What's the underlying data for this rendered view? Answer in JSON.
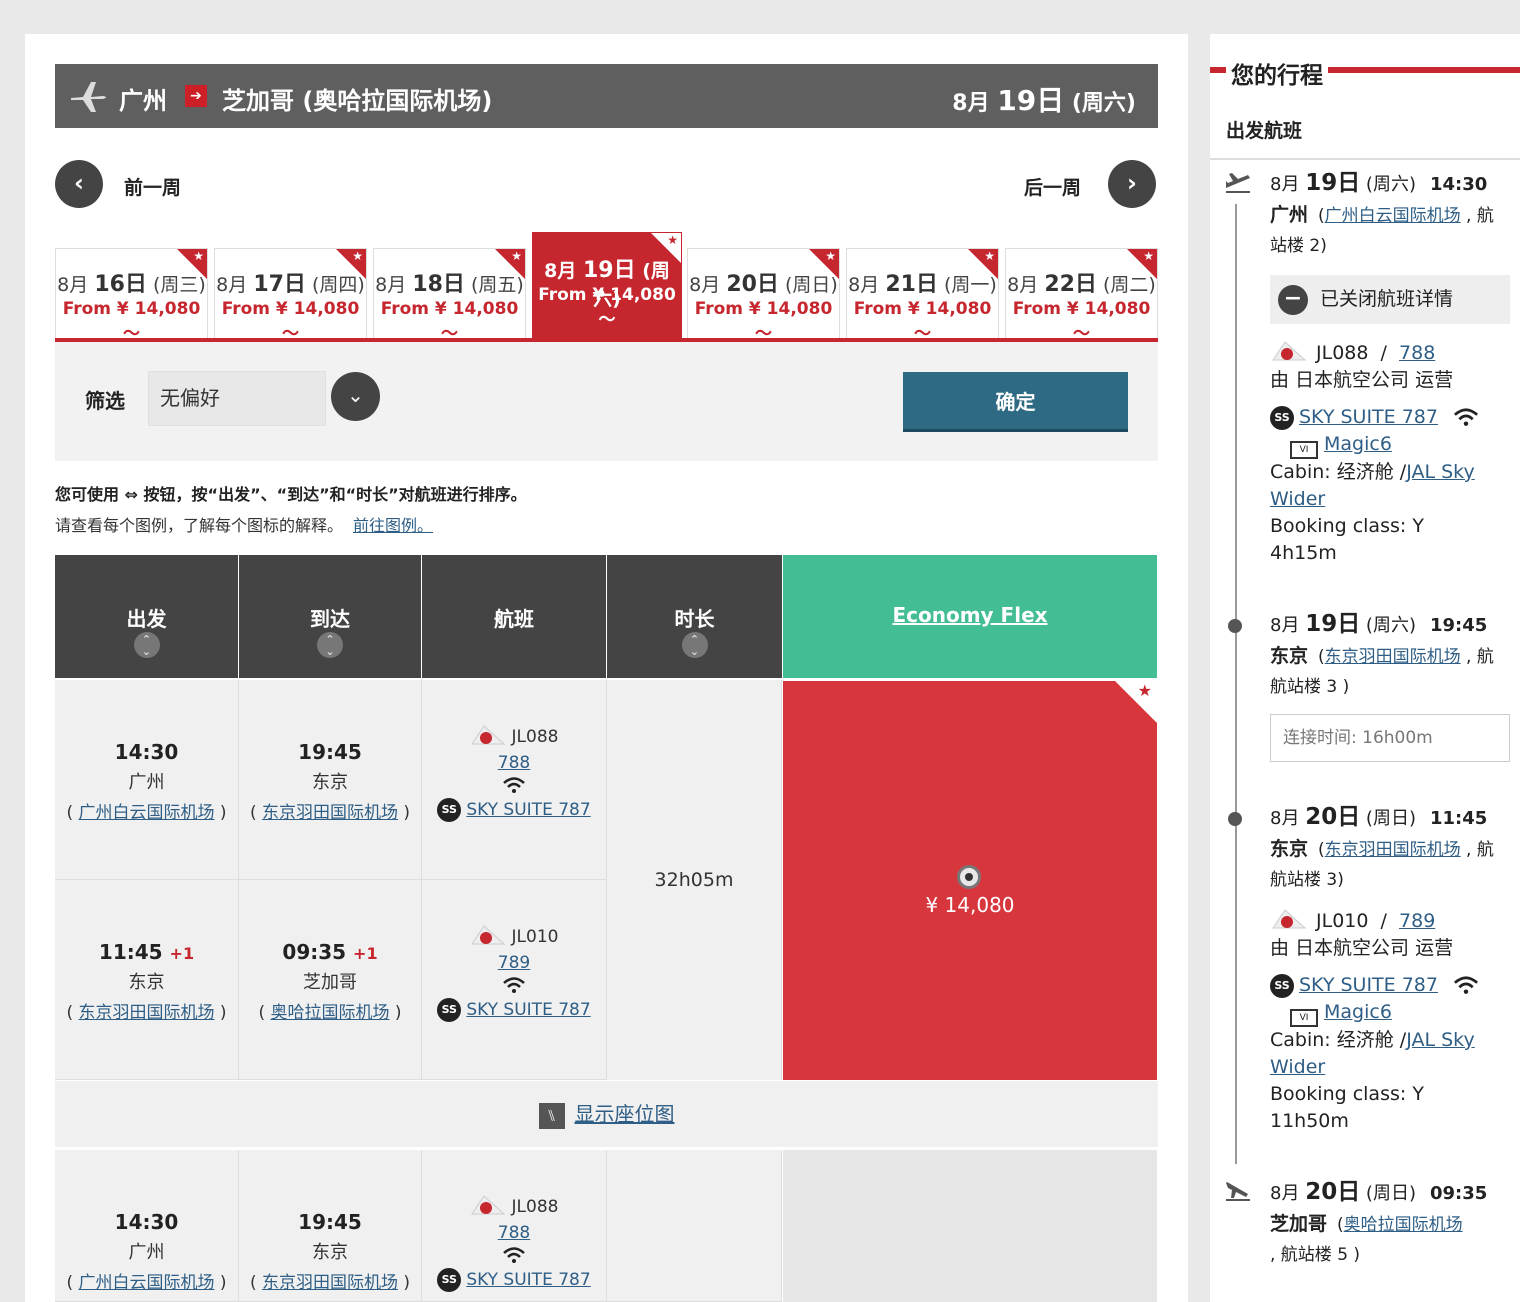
{
  "route": {
    "from": "广州",
    "to": "芝加哥 (奥哈拉国际机场)",
    "date_prefix": "8月 ",
    "date_day": "19日",
    "date_suffix": " (周六)"
  },
  "week_nav": {
    "prev": "前一周",
    "next": "后一周"
  },
  "date_tabs": [
    {
      "m": "8月 ",
      "d": "16日",
      "w": " (周三)",
      "price": "From ¥ 14,080 ～"
    },
    {
      "m": "8月 ",
      "d": "17日",
      "w": " (周四)",
      "price": "From ¥ 14,080 ～"
    },
    {
      "m": "8月 ",
      "d": "18日",
      "w": " (周五)",
      "price": "From ¥ 14,080 ～"
    },
    {
      "m": "8月 ",
      "d": "19日",
      "w": " (周六)",
      "price": "From ¥ 14,080 ～"
    },
    {
      "m": "8月 ",
      "d": "20日",
      "w": " (周日)",
      "price": "From ¥ 14,080 ～"
    },
    {
      "m": "8月 ",
      "d": "21日",
      "w": " (周一)",
      "price": "From ¥ 14,080 ～"
    },
    {
      "m": "8月 ",
      "d": "22日",
      "w": " (周二)",
      "price": "From ¥ 14,080 ～"
    }
  ],
  "filter": {
    "label": "筛选",
    "value": "无偏好",
    "confirm": "确定"
  },
  "hints": {
    "sort": "您可使用 ⇔ 按钮，按“出发”、“到达”和“时长”对航班进行排序。",
    "legend": "请查看每个图例，了解每个图标的解释。",
    "legend_link": "前往图例。"
  },
  "table_headers": {
    "dep": "出发",
    "arr": "到达",
    "flight": "航班",
    "dur": "时长",
    "fare": "Economy Flex"
  },
  "segments": [
    {
      "dep_time": "14:30",
      "dep_plus": "",
      "dep_city": "广州",
      "dep_ap": "广州白云国际机场",
      "arr_time": "19:45",
      "arr_plus": "",
      "arr_city": "东京",
      "arr_ap": "东京羽田国际机场",
      "flight": "JL088",
      "aircraft": "788",
      "suite": "SKY SUITE 787"
    },
    {
      "dep_time": "11:45",
      "dep_plus": "+1",
      "dep_city": "东京",
      "dep_ap": "东京羽田国际机场",
      "arr_time": "09:35",
      "arr_plus": "+1",
      "arr_city": "芝加哥",
      "arr_ap": "奥哈拉国际机场",
      "flight": "JL010",
      "aircraft": "789",
      "suite": "SKY SUITE 787"
    },
    {
      "dep_time": "14:30",
      "dep_plus": "",
      "dep_city": "广州",
      "dep_ap": "广州白云国际机场",
      "arr_time": "19:45",
      "arr_plus": "",
      "arr_city": "东京",
      "arr_ap": "东京羽田国际机场",
      "flight": "JL088",
      "aircraft": "788",
      "suite": "SKY SUITE 787"
    }
  ],
  "duration": "32h05m",
  "fare_price": "¥ 14,080",
  "seatmap": "显示座位图",
  "sidebar": {
    "title": "您的行程",
    "subtitle": "出发航班",
    "closed_details": "已关闭航班详情",
    "connection": "连接时间:   16h00m",
    "stops": [
      {
        "m": "8月 ",
        "d": "19日",
        "w": " (周六)",
        "time": "14:30",
        "city": "广州",
        "ap": "广州白云国际机场",
        "ter": "航站楼  2)"
      },
      {
        "m": "8月 ",
        "d": "19日",
        "w": " (周六)",
        "time": "19:45",
        "city": "东京",
        "ap": "东京羽田国际机场",
        "ter": "航站楼   3 )"
      },
      {
        "m": "8月 ",
        "d": "20日",
        "w": " (周日)",
        "time": "11:45",
        "city": "东京",
        "ap": "东京羽田国际机场",
        "ter": "航站楼  3)"
      },
      {
        "m": "8月 ",
        "d": "20日",
        "w": " (周日)",
        "time": "09:35",
        "city": "芝加哥",
        "ap": "奥哈拉国际机场",
        "ter": ", 航站楼   5 )"
      }
    ],
    "flights": [
      {
        "no": "JL088",
        "ac": "788",
        "op": "由 日本航空公司 运营",
        "suite": "SKY SUITE 787",
        "ent": "Magic6",
        "cabin_label": "Cabin: 经济舱 /",
        "cabin_link": "JAL Sky Wider",
        "booking": "Booking class: Y",
        "dur": "4h15m"
      },
      {
        "no": "JL010",
        "ac": "789",
        "op": "由 日本航空公司 运营",
        "suite": "SKY SUITE 787",
        "ent": "Magic6",
        "cabin_label": "Cabin: 经济舱 /",
        "cabin_link": "JAL Sky Wider",
        "booking": "Booking class: Y",
        "dur": "11h50m"
      }
    ]
  },
  "colors": {
    "accent_red": "#c6262d",
    "fare_green": "#43bd93",
    "header_gray": "#444444",
    "confirm_blue": "#2f6a84"
  }
}
